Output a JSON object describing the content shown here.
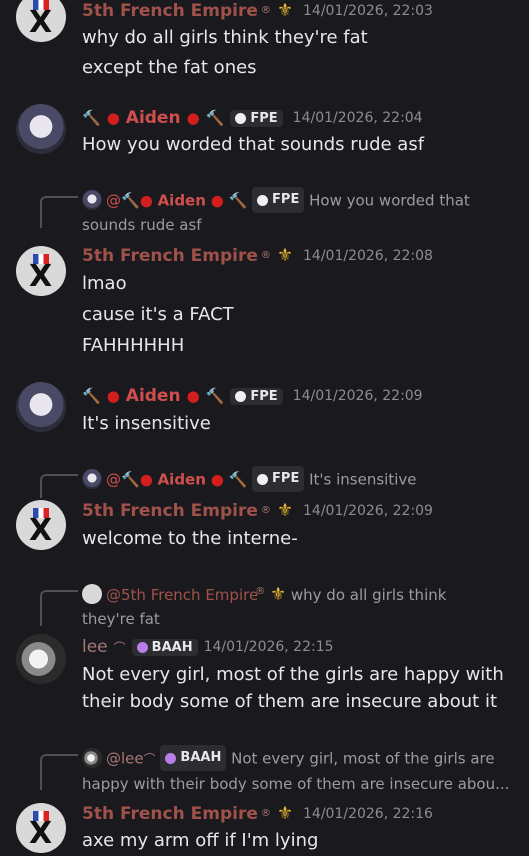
{
  "messages": [
    {
      "author": "5th French Empire",
      "timestamp": "14/01/2026, 22:03",
      "lines": [
        "why do all girls think they're fat",
        "except the fat ones"
      ]
    },
    {
      "author": "Aiden",
      "tag": "FPE",
      "timestamp": "14/01/2026, 22:04",
      "lines": [
        "How you worded that sounds rude asf"
      ]
    },
    {
      "reply": {
        "mention": "@",
        "author": "Aiden",
        "tag": "FPE",
        "text1": "How you worded that",
        "text2": "sounds rude asf"
      },
      "author": "5th French Empire",
      "timestamp": "14/01/2026, 22:08",
      "lines": [
        "lmao",
        "cause it's a FACT",
        "FAHHHHHH"
      ]
    },
    {
      "author": "Aiden",
      "tag": "FPE",
      "timestamp": "14/01/2026, 22:09",
      "lines": [
        "It's insensitive"
      ]
    },
    {
      "reply": {
        "mention": "@",
        "author": "Aiden",
        "tag": "FPE",
        "text1": "It's insensitive"
      },
      "author": "5th French Empire",
      "timestamp": "14/01/2026, 22:09",
      "lines": [
        "welcome to the interne-"
      ]
    },
    {
      "reply": {
        "mention": "@5th French Empire",
        "text1": "why do all girls think",
        "text2": "they're fat"
      },
      "author": "lee",
      "tag": "BAAH",
      "timestamp": "14/01/2026, 22:15",
      "lines": [
        "Not every girl, most of the girls are happy with",
        "their body some of them are insecure about it"
      ]
    },
    {
      "reply": {
        "mention": "@lee",
        "tag": "BAAH",
        "text1": "Not every girl, most of the girls are",
        "text2": "happy with their body some of them are insecure abou..."
      },
      "author": "5th French Empire",
      "timestamp": "14/01/2026, 22:16",
      "lines": [
        "axe my arm off if I'm lying"
      ]
    }
  ],
  "icons": {
    "fleur": "fleur-de-lis",
    "hammer": "hammer",
    "drop": "blood-drop"
  },
  "colors": {
    "background": "#1a1a1e",
    "fe_name": "#a0524a",
    "aiden_name": "#cf4f4f",
    "lee_name": "#a87777",
    "timestamp": "#8a8d93"
  }
}
